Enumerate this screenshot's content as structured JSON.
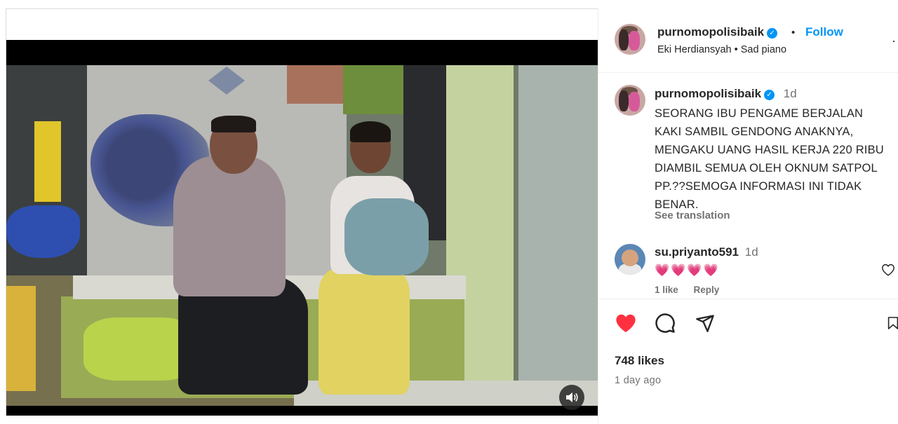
{
  "post": {
    "author": "purnomopolisibaik",
    "follow_label": "Follow",
    "separator": "•",
    "audio_artist": "Eki Herdiansyah",
    "audio_track": "Sad piano",
    "more_glyph": "·",
    "caption_time": "1d",
    "caption": "SEORANG IBU PENGAME BERJALAN KAKI SAMBIL GENDONG ANAKNYA, MENGAKU UANG HASIL KERJA 220 RIBU DIAMBIL SEMUA OLEH OKNUM SATPOL PP.??SEMOGA INFORMASI INI TIDAK BENAR.",
    "see_translation": "See translation",
    "likes_text": "748 likes",
    "posted_ago": "1 day ago"
  },
  "comment": {
    "user": "su.priyanto591",
    "time": "1d",
    "text": "💗💗💗💗",
    "likes_label": "1 like",
    "reply_label": "Reply"
  },
  "icons": {
    "verified": "verified-badge-icon",
    "volume": "volume-icon",
    "heart": "heart-icon",
    "comment": "comment-icon",
    "share": "share-icon",
    "save": "save-icon",
    "comment_like": "heart-outline-icon"
  },
  "colors": {
    "accent": "#0095f6",
    "like_red": "#ff3040",
    "text_primary": "#262626",
    "text_secondary": "#737373"
  }
}
